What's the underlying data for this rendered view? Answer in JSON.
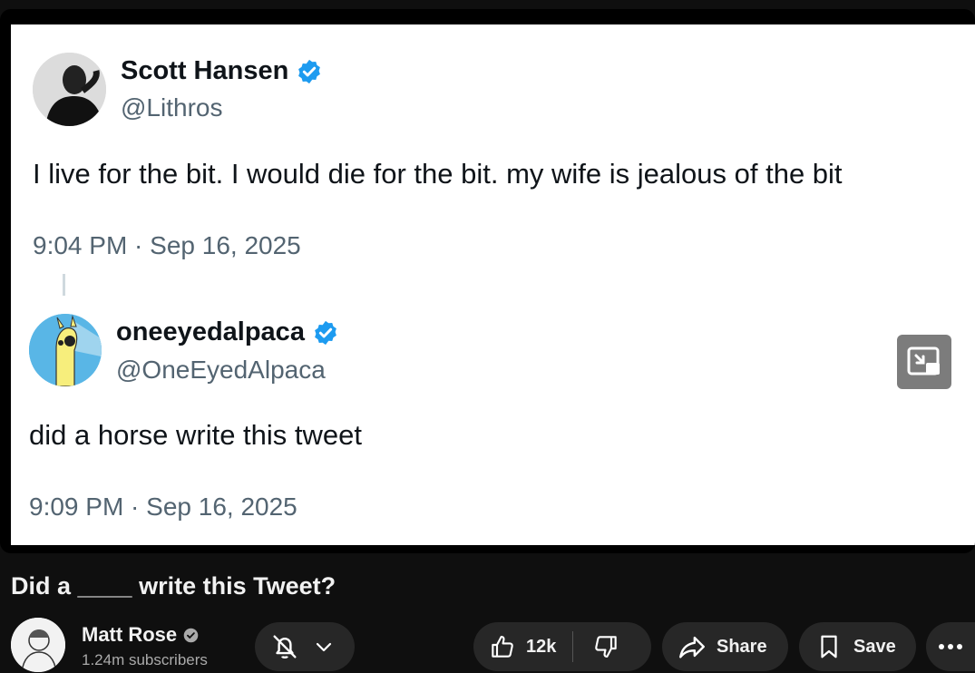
{
  "tweets": [
    {
      "name": "Scott Hansen",
      "handle": "@Lithros",
      "text": "I live for the bit. I would die for the bit. my wife is jealous of the bit",
      "timestamp": "9:04 PM · Sep 16, 2025"
    },
    {
      "name": "oneeyedalpaca",
      "handle": "@OneEyedAlpaca",
      "text": "did a horse write this tweet",
      "timestamp": "9:09 PM · Sep 16, 2025"
    }
  ],
  "video": {
    "title": "Did a ____ write this Tweet?"
  },
  "channel": {
    "name": "Matt Rose",
    "subscribers": "1.24m subscribers"
  },
  "actions": {
    "like_count": "12k",
    "share_label": "Share",
    "save_label": "Save"
  },
  "colors": {
    "verified_blue": "#1d9bf0",
    "page_background": "#0f0f0f",
    "pill_background": "#272727"
  },
  "icons": [
    "verified-badge-icon",
    "pip-icon",
    "bell-off-icon",
    "chevron-down-icon",
    "thumbs-up-icon",
    "thumbs-down-icon",
    "share-arrow-icon",
    "bookmark-icon",
    "more-icon"
  ]
}
